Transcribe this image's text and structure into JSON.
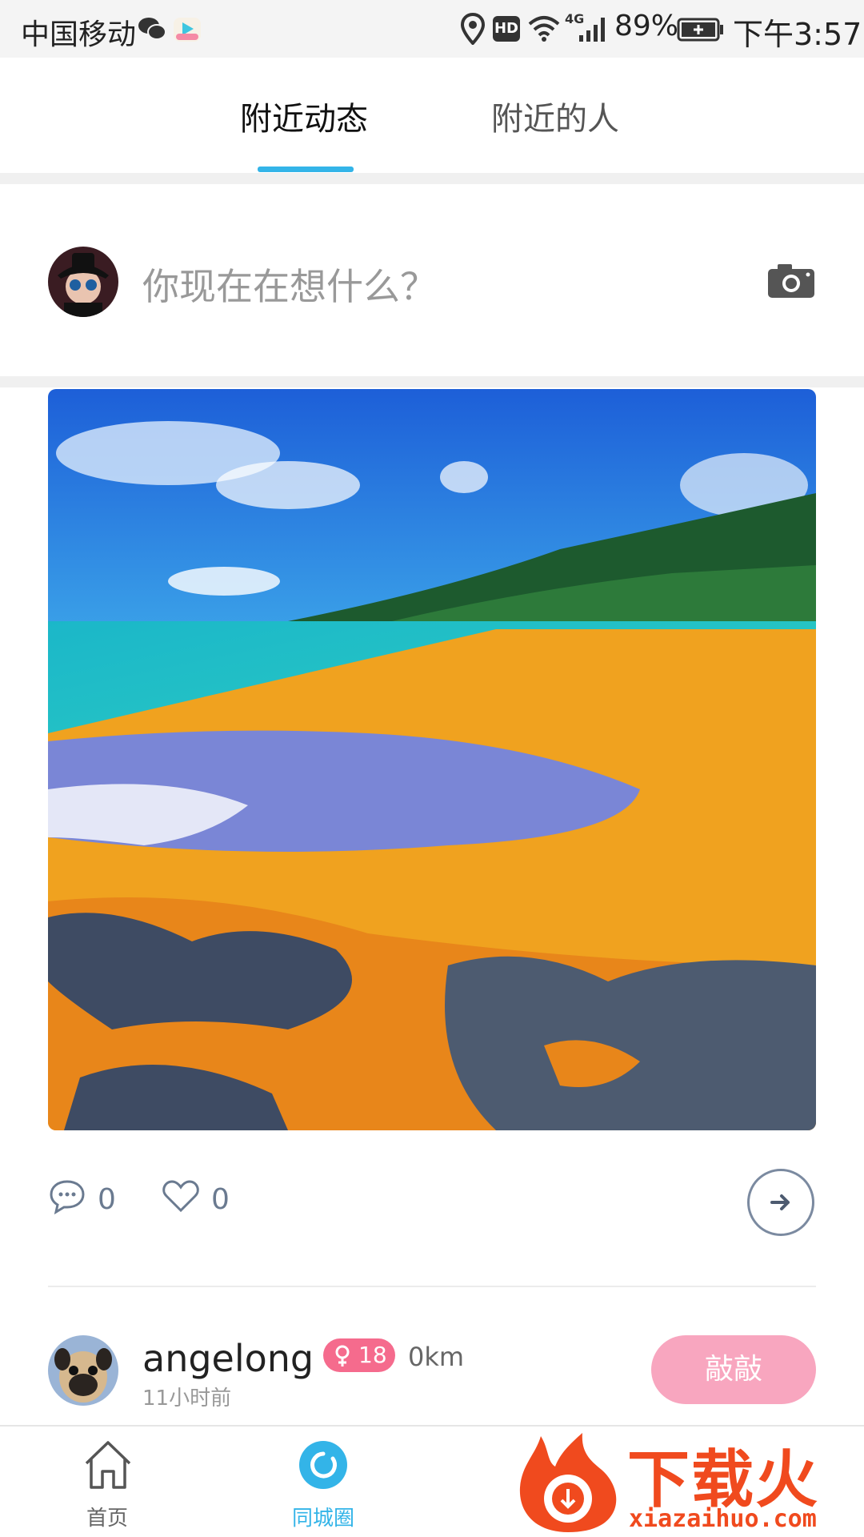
{
  "status_bar": {
    "carrier": "中国移动",
    "network_label": "4G",
    "hd_label": "HD",
    "battery": "89%",
    "time": "下午3:57",
    "icons": [
      "wechat-icon",
      "video-app-icon",
      "location-icon",
      "hd-icon",
      "wifi-icon",
      "signal-icon",
      "battery-icon"
    ]
  },
  "tabs": [
    {
      "label": "附近动态",
      "active": true
    },
    {
      "label": "附近的人",
      "active": false
    }
  ],
  "compose": {
    "placeholder": "你现在在想什么？",
    "camera_icon": "camera-icon"
  },
  "post": {
    "image": "beach-photo",
    "comment_count": "0",
    "like_count": "0"
  },
  "next_post": {
    "username": "angelong",
    "age": "18",
    "distance": "0km",
    "time_ago": "11小时前",
    "knock_label": "敲敲"
  },
  "bottom_nav": [
    {
      "label": "首页",
      "icon": "home-icon",
      "active": false
    },
    {
      "label": "同城圈",
      "icon": "circle-icon",
      "active": true
    }
  ],
  "watermark": {
    "title": "下载火",
    "url": "xiazaihuo.com"
  },
  "colors": {
    "accent": "#33b4e8",
    "badge": "#f56b8d",
    "knock": "#f8a6bf",
    "watermark": "#f04a1e"
  }
}
